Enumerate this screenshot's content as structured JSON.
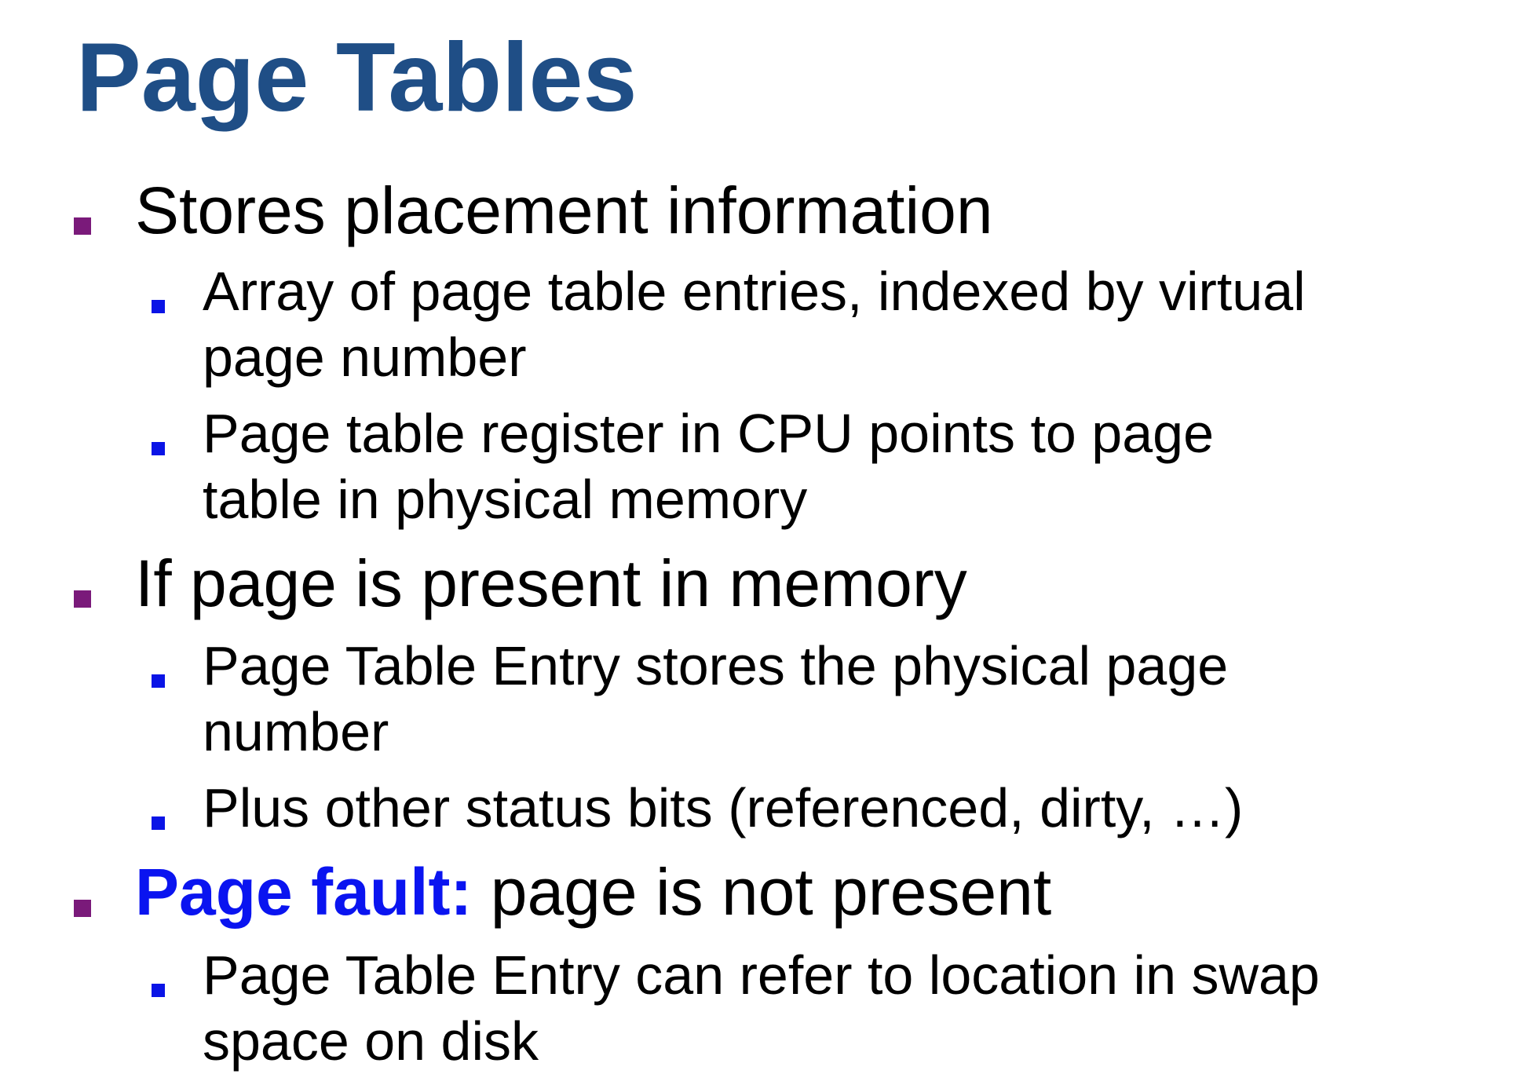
{
  "slide": {
    "title": "Page Tables",
    "colors": {
      "title": "#1f4e86",
      "level1_bullet": "#7a1a7a",
      "level2_bullet": "#0a14e6",
      "highlight": "#0a14f0"
    },
    "items": [
      {
        "text": "Stores placement information",
        "subitems": [
          {
            "lines": [
              "Array of page table entries, indexed by virtual",
              "page number"
            ]
          },
          {
            "lines": [
              "Page table register in CPU points to page",
              "table in physical memory"
            ]
          }
        ]
      },
      {
        "text": "If page is present in memory",
        "subitems": [
          {
            "lines": [
              "Page Table Entry stores the physical page",
              "number"
            ]
          },
          {
            "lines": [
              "Plus other status bits (referenced, dirty, …)"
            ]
          }
        ]
      },
      {
        "highlight": "Page fault:",
        "text": " page is not present",
        "subitems": [
          {
            "lines": [
              "Page Table Entry can refer to location in swap",
              "space on disk"
            ]
          }
        ]
      }
    ]
  }
}
